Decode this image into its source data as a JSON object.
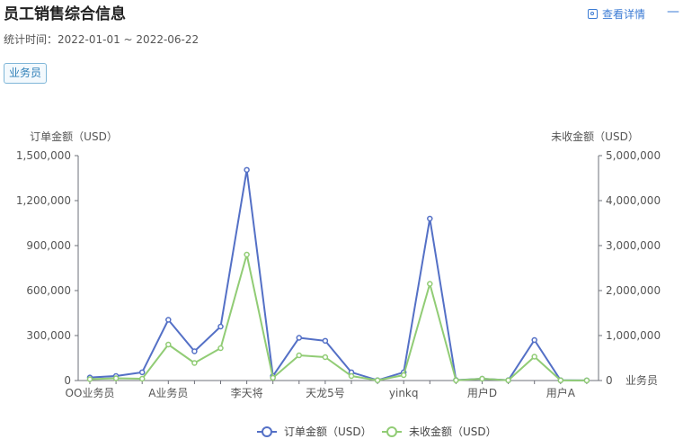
{
  "header": {
    "title": "员工销售综合信息",
    "subtitle": "统计时间：2022-01-01 ~ 2022-06-22",
    "detail_label": "查看详情",
    "collapse_label": "—",
    "filter_tag": "业务员"
  },
  "chart_data": {
    "type": "line",
    "xlabel": "业务员",
    "categories": [
      "OO业务员",
      "",
      "",
      "A业务员",
      "",
      "",
      "李天将",
      "",
      "",
      "天龙5号",
      "",
      "",
      "yinkq",
      "",
      "",
      "用户D",
      "",
      "",
      "用户A",
      ""
    ],
    "x_tick_labels": [
      "OO业务员",
      "A业务员",
      "李天将",
      "天龙5号",
      "yinkq",
      "用户D",
      "用户A"
    ],
    "y_left": {
      "label": "订单金额（USD）",
      "range": [
        0,
        1500000
      ],
      "ticks": [
        "0",
        "300,000",
        "600,000",
        "900,000",
        "1,200,000",
        "1,500,000"
      ]
    },
    "y_right": {
      "label": "未收金额（USD）",
      "range": [
        0,
        5000000
      ],
      "ticks": [
        "0",
        "1,000,000",
        "2,000,000",
        "3,000,000",
        "4,000,000",
        "5,000,000"
      ]
    },
    "series": [
      {
        "name": "订单金额（USD）",
        "axis": "left",
        "color": "#5470c6",
        "values": [
          20000,
          30000,
          55000,
          405000,
          195000,
          360000,
          1405000,
          30000,
          285000,
          265000,
          55000,
          2000,
          55000,
          1080000,
          3000,
          12000,
          2000,
          270000,
          2000,
          1000
        ]
      },
      {
        "name": "未收金额（USD）",
        "axis": "right",
        "color": "#91cc75",
        "values": [
          30000,
          50000,
          40000,
          800000,
          390000,
          720000,
          2800000,
          60000,
          560000,
          520000,
          100000,
          5000,
          120000,
          2150000,
          4000,
          40000,
          5000,
          530000,
          4000,
          2000
        ]
      }
    ],
    "grid": false,
    "legend_position": "bottom-center"
  }
}
